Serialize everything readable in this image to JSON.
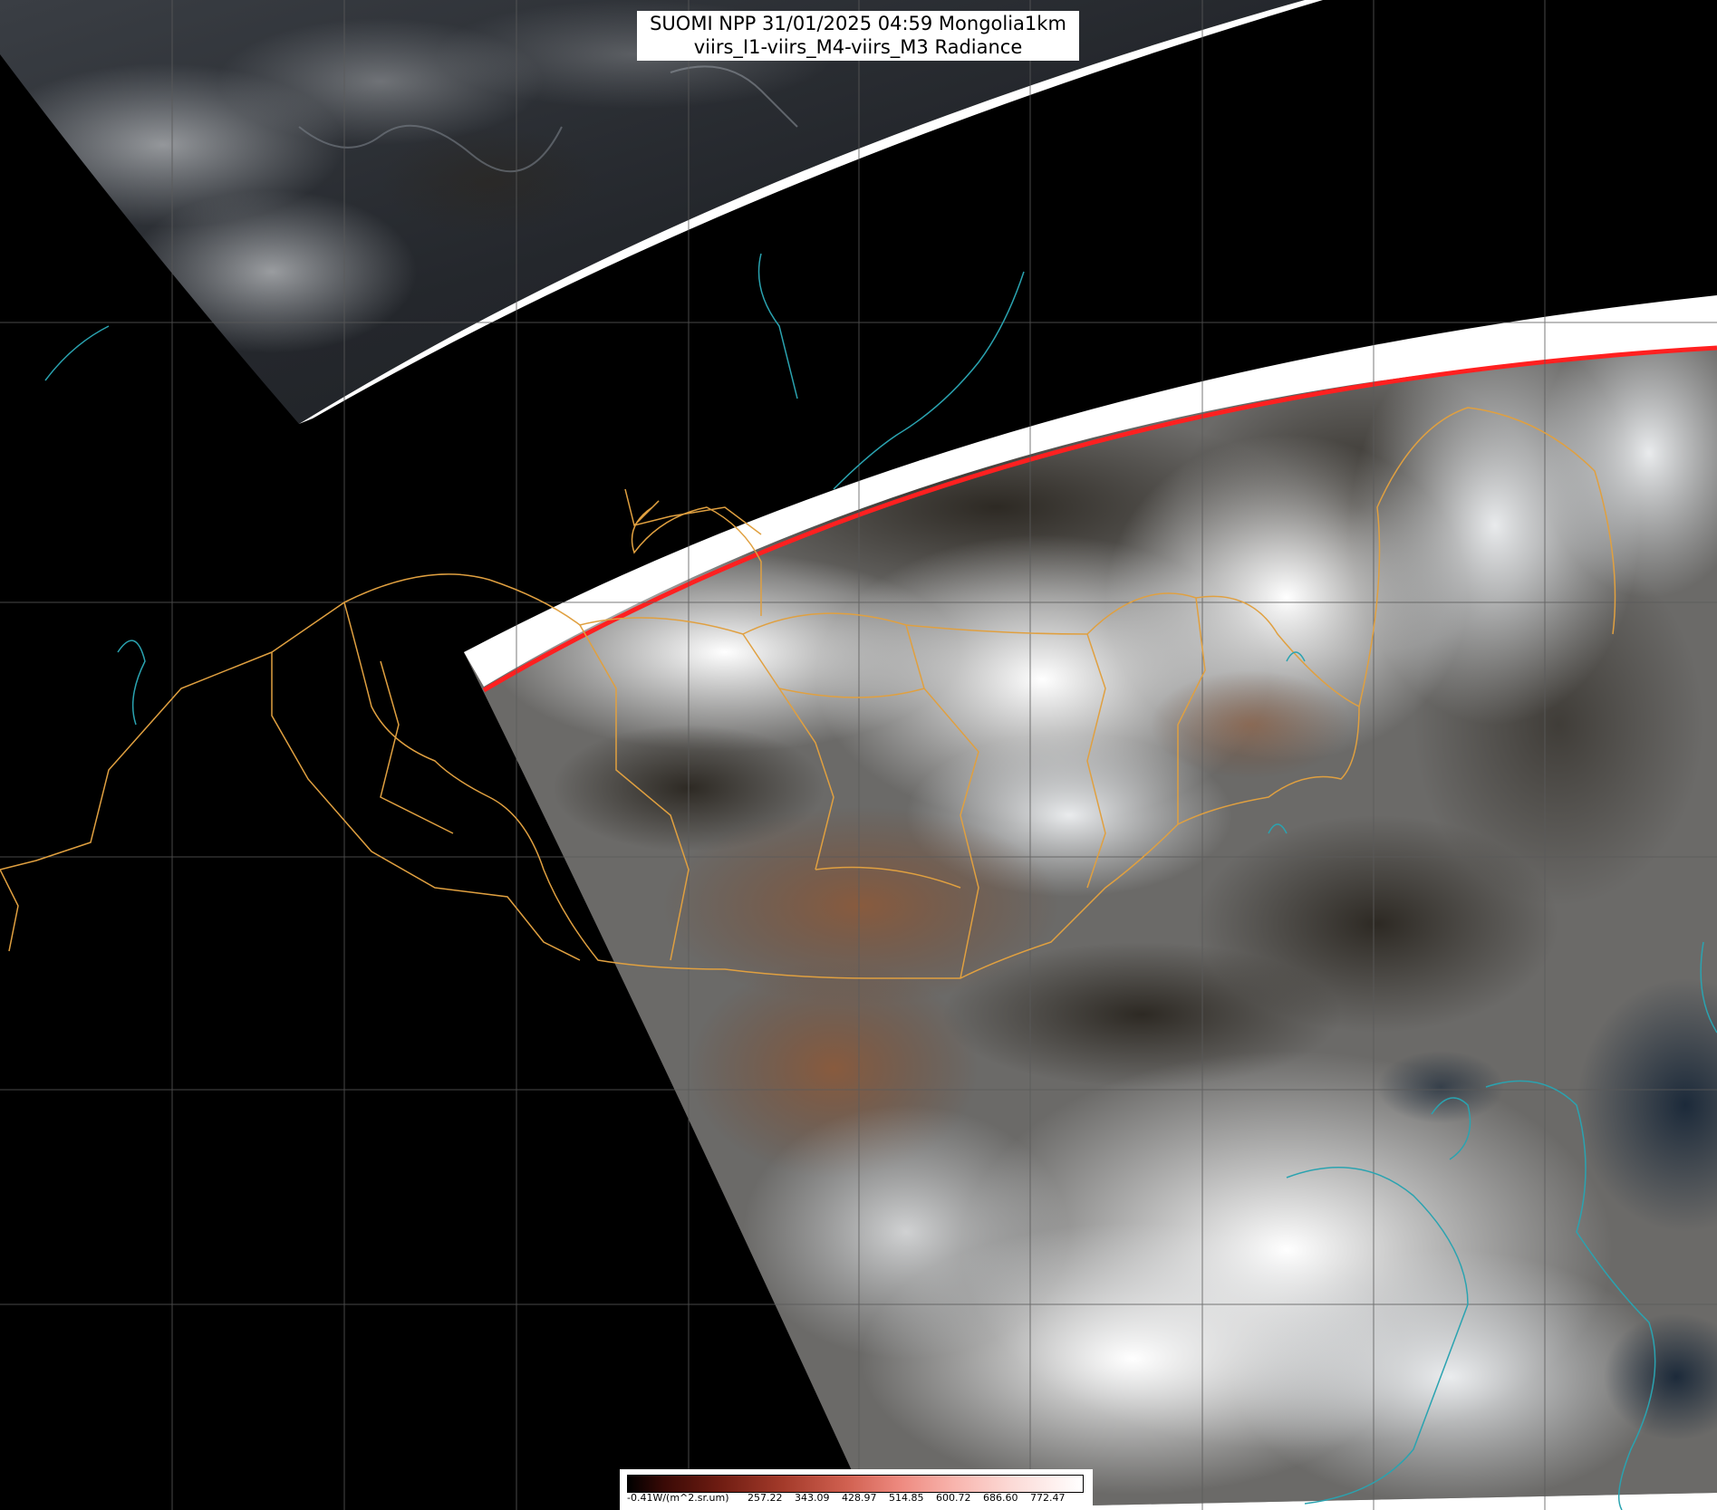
{
  "title": {
    "line1": "SUOMI NPP 31/01/2025 04:59 Mongolia1km",
    "line2": "viirs_I1-viirs_M4-viirs_M3 Radiance"
  },
  "colorbar": {
    "tick_labels": [
      "-0.41W/(m^2.sr.um)",
      "257.22",
      "343.09",
      "428.97",
      "514.85",
      "600.72",
      "686.60",
      "772.47"
    ],
    "gradient_colors": [
      "#000000",
      "#6e1c12",
      "#d06050",
      "#f8b5ae",
      "#ffffff"
    ]
  },
  "map": {
    "region": "Mongolia",
    "colors": {
      "background": "#000000",
      "graticule": "#5a5a5a",
      "admin_border": "#e0a040",
      "coastline": "#2aa3b0",
      "swath_edge": "#ff2020",
      "cloud": "#e8ecef",
      "desert": "#8a5a3c"
    }
  }
}
